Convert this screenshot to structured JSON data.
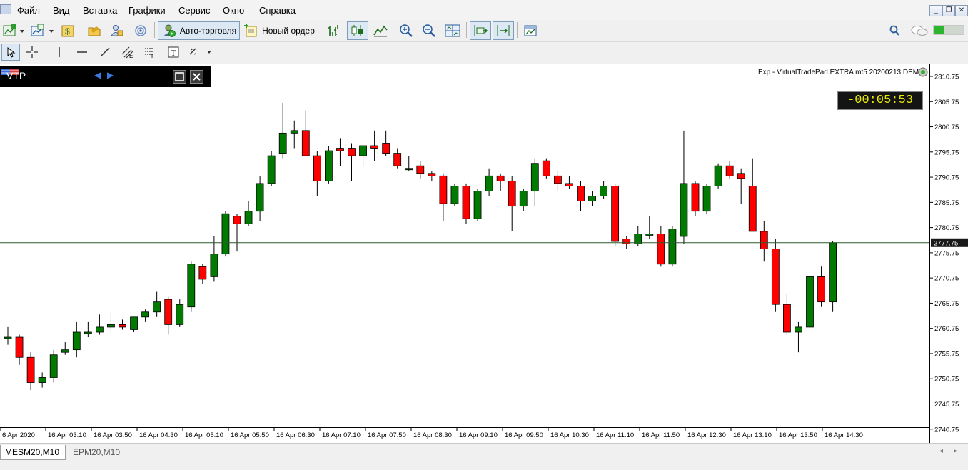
{
  "menu": [
    "Файл",
    "Вид",
    "Вставка",
    "Графики",
    "Сервис",
    "Окно",
    "Справка"
  ],
  "toolbar": {
    "autotrade_label": "Авто-торговля",
    "neworder_label": "Новый ордер"
  },
  "vtp": {
    "title": "VTP"
  },
  "expert_label": "Exp - VirtualTradePad EXTRA mt5 20200213 DEMO",
  "timer": "-00:05:53",
  "current_price": "2777.75",
  "tabs": [
    "MESM20,M10",
    "EPM20,M10"
  ],
  "colors": {
    "bull": "#007a00",
    "bear": "#ff0000",
    "price_line": "#2e5a2e",
    "timer_text": "#e8e800"
  },
  "chart_data": {
    "type": "candlestick",
    "symbol": "MESM20",
    "timeframe": "M10",
    "y_ticks": [
      "2810.75",
      "2805.75",
      "2800.75",
      "2795.75",
      "2790.75",
      "2785.75",
      "2780.75",
      "2775.75",
      "2770.75",
      "2765.75",
      "2760.75",
      "2755.75",
      "2750.75",
      "2745.75",
      "2740.75"
    ],
    "x_ticks": [
      "6 Apr 2020",
      "16 Apr 03:10",
      "16 Apr 03:50",
      "16 Apr 04:30",
      "16 Apr 05:10",
      "16 Apr 05:50",
      "16 Apr 06:30",
      "16 Apr 07:10",
      "16 Apr 07:50",
      "16 Apr 08:30",
      "16 Apr 09:10",
      "16 Apr 09:50",
      "16 Apr 10:30",
      "16 Apr 11:10",
      "16 Apr 11:50",
      "16 Apr 12:30",
      "16 Apr 13:10",
      "16 Apr 13:50",
      "16 Apr 14:30"
    ],
    "ylim": [
      2737.5,
      2812.5
    ],
    "candles": [
      {
        "o": 2759.0,
        "h": 2761.0,
        "l": 2757.5,
        "c": 2759.0
      },
      {
        "o": 2759.0,
        "h": 2759.5,
        "l": 2753.5,
        "c": 2755.0
      },
      {
        "o": 2755.0,
        "h": 2756.0,
        "l": 2748.5,
        "c": 2750.0
      },
      {
        "o": 2750.0,
        "h": 2752.0,
        "l": 2749.0,
        "c": 2751.0
      },
      {
        "o": 2751.0,
        "h": 2756.5,
        "l": 2750.0,
        "c": 2755.5
      },
      {
        "o": 2756.0,
        "h": 2758.0,
        "l": 2755.5,
        "c": 2756.5
      },
      {
        "o": 2756.5,
        "h": 2762.0,
        "l": 2755.0,
        "c": 2760.0
      },
      {
        "o": 2760.0,
        "h": 2762.0,
        "l": 2759.0,
        "c": 2760.0
      },
      {
        "o": 2760.0,
        "h": 2763.5,
        "l": 2759.5,
        "c": 2761.0
      },
      {
        "o": 2761.0,
        "h": 2764.0,
        "l": 2760.0,
        "c": 2761.5
      },
      {
        "o": 2761.5,
        "h": 2762.5,
        "l": 2760.5,
        "c": 2761.0
      },
      {
        "o": 2760.5,
        "h": 2763.0,
        "l": 2760.0,
        "c": 2763.0
      },
      {
        "o": 2763.0,
        "h": 2764.5,
        "l": 2762.0,
        "c": 2764.0
      },
      {
        "o": 2764.0,
        "h": 2768.0,
        "l": 2763.0,
        "c": 2766.0
      },
      {
        "o": 2766.5,
        "h": 2767.0,
        "l": 2759.5,
        "c": 2761.5
      },
      {
        "o": 2761.5,
        "h": 2766.5,
        "l": 2761.0,
        "c": 2765.5
      },
      {
        "o": 2765.0,
        "h": 2774.0,
        "l": 2764.0,
        "c": 2773.5
      },
      {
        "o": 2773.0,
        "h": 2773.5,
        "l": 2769.5,
        "c": 2770.5
      },
      {
        "o": 2771.0,
        "h": 2779.0,
        "l": 2770.0,
        "c": 2775.5
      },
      {
        "o": 2775.5,
        "h": 2784.0,
        "l": 2775.0,
        "c": 2783.5
      },
      {
        "o": 2783.0,
        "h": 2783.5,
        "l": 2776.0,
        "c": 2781.5
      },
      {
        "o": 2781.5,
        "h": 2786.0,
        "l": 2781.0,
        "c": 2784.0
      },
      {
        "o": 2784.0,
        "h": 2791.0,
        "l": 2782.0,
        "c": 2789.5
      },
      {
        "o": 2789.5,
        "h": 2796.0,
        "l": 2789.0,
        "c": 2795.0
      },
      {
        "o": 2795.5,
        "h": 2805.5,
        "l": 2794.5,
        "c": 2799.5
      },
      {
        "o": 2799.5,
        "h": 2802.0,
        "l": 2796.5,
        "c": 2800.0
      },
      {
        "o": 2800.0,
        "h": 2804.0,
        "l": 2795.0,
        "c": 2795.0
      },
      {
        "o": 2795.0,
        "h": 2796.0,
        "l": 2787.0,
        "c": 2790.0
      },
      {
        "o": 2790.0,
        "h": 2797.0,
        "l": 2789.5,
        "c": 2796.0
      },
      {
        "o": 2796.5,
        "h": 2798.5,
        "l": 2793.0,
        "c": 2796.0
      },
      {
        "o": 2796.5,
        "h": 2797.5,
        "l": 2790.0,
        "c": 2795.0
      },
      {
        "o": 2795.0,
        "h": 2797.0,
        "l": 2793.0,
        "c": 2797.0
      },
      {
        "o": 2797.0,
        "h": 2800.0,
        "l": 2794.0,
        "c": 2796.5
      },
      {
        "o": 2797.5,
        "h": 2800.0,
        "l": 2795.0,
        "c": 2795.5
      },
      {
        "o": 2795.5,
        "h": 2796.5,
        "l": 2792.5,
        "c": 2793.0
      },
      {
        "o": 2792.5,
        "h": 2795.0,
        "l": 2792.0,
        "c": 2792.5
      },
      {
        "o": 2793.0,
        "h": 2794.0,
        "l": 2790.5,
        "c": 2791.5
      },
      {
        "o": 2791.5,
        "h": 2792.0,
        "l": 2790.0,
        "c": 2791.0
      },
      {
        "o": 2791.0,
        "h": 2791.5,
        "l": 2782.0,
        "c": 2785.5
      },
      {
        "o": 2785.5,
        "h": 2789.5,
        "l": 2785.0,
        "c": 2789.0
      },
      {
        "o": 2789.0,
        "h": 2789.5,
        "l": 2781.5,
        "c": 2782.5
      },
      {
        "o": 2782.5,
        "h": 2788.5,
        "l": 2782.0,
        "c": 2788.0
      },
      {
        "o": 2788.0,
        "h": 2792.5,
        "l": 2787.0,
        "c": 2791.0
      },
      {
        "o": 2791.0,
        "h": 2791.5,
        "l": 2788.0,
        "c": 2790.0
      },
      {
        "o": 2790.0,
        "h": 2791.0,
        "l": 2780.0,
        "c": 2785.0
      },
      {
        "o": 2785.0,
        "h": 2788.5,
        "l": 2784.0,
        "c": 2788.0
      },
      {
        "o": 2788.0,
        "h": 2794.5,
        "l": 2785.0,
        "c": 2793.5
      },
      {
        "o": 2794.0,
        "h": 2794.5,
        "l": 2790.5,
        "c": 2791.0
      },
      {
        "o": 2791.0,
        "h": 2792.0,
        "l": 2788.0,
        "c": 2789.5
      },
      {
        "o": 2789.5,
        "h": 2791.0,
        "l": 2788.5,
        "c": 2789.0
      },
      {
        "o": 2789.0,
        "h": 2790.0,
        "l": 2784.0,
        "c": 2786.0
      },
      {
        "o": 2786.0,
        "h": 2788.0,
        "l": 2785.0,
        "c": 2787.0
      },
      {
        "o": 2787.0,
        "h": 2790.0,
        "l": 2786.5,
        "c": 2789.0
      },
      {
        "o": 2789.0,
        "h": 2789.5,
        "l": 2777.0,
        "c": 2778.0
      },
      {
        "o": 2778.5,
        "h": 2779.0,
        "l": 2776.5,
        "c": 2777.5
      },
      {
        "o": 2777.5,
        "h": 2781.0,
        "l": 2777.0,
        "c": 2779.5
      },
      {
        "o": 2779.5,
        "h": 2783.0,
        "l": 2778.5,
        "c": 2779.5
      },
      {
        "o": 2779.5,
        "h": 2781.0,
        "l": 2773.0,
        "c": 2773.5
      },
      {
        "o": 2773.5,
        "h": 2781.0,
        "l": 2773.0,
        "c": 2780.5
      },
      {
        "o": 2779.0,
        "h": 2800.0,
        "l": 2777.5,
        "c": 2789.5
      },
      {
        "o": 2789.5,
        "h": 2790.0,
        "l": 2783.0,
        "c": 2784.0
      },
      {
        "o": 2784.0,
        "h": 2789.5,
        "l": 2783.5,
        "c": 2789.0
      },
      {
        "o": 2789.0,
        "h": 2793.5,
        "l": 2788.5,
        "c": 2793.0
      },
      {
        "o": 2793.0,
        "h": 2794.0,
        "l": 2790.5,
        "c": 2791.0
      },
      {
        "o": 2791.5,
        "h": 2792.5,
        "l": 2785.5,
        "c": 2790.5
      },
      {
        "o": 2789.0,
        "h": 2794.5,
        "l": 2780.5,
        "c": 2780.0
      },
      {
        "o": 2780.0,
        "h": 2782.0,
        "l": 2774.0,
        "c": 2776.5
      },
      {
        "o": 2776.5,
        "h": 2778.5,
        "l": 2764.0,
        "c": 2765.5
      },
      {
        "o": 2765.5,
        "h": 2767.5,
        "l": 2759.5,
        "c": 2760.0
      },
      {
        "o": 2760.0,
        "h": 2762.0,
        "l": 2756.0,
        "c": 2761.0
      },
      {
        "o": 2761.0,
        "h": 2772.0,
        "l": 2759.5,
        "c": 2771.0
      },
      {
        "o": 2771.0,
        "h": 2773.0,
        "l": 2765.0,
        "c": 2766.0
      },
      {
        "o": 2766.0,
        "h": 2778.0,
        "l": 2764.0,
        "c": 2777.75
      }
    ]
  }
}
